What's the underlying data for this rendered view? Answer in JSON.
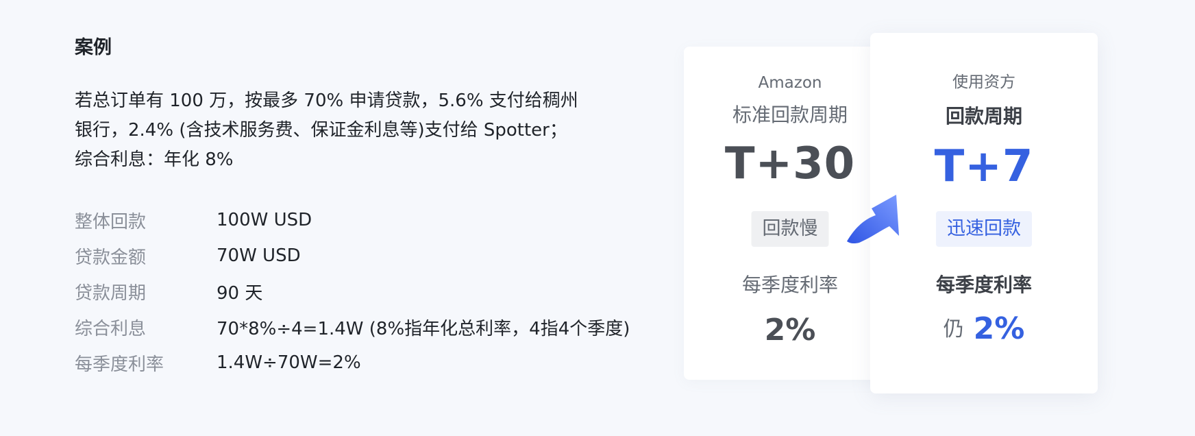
{
  "case": {
    "title": "案例",
    "lines": [
      "若总订单有 100 万，按最多 70% 申请贷款，5.6% 支付给稠州",
      "银行，2.4% (含技术服务费、保证金利息等)支付给 Spotter；",
      "综合利息：年化 8%"
    ],
    "rows": [
      {
        "label": "整体回款",
        "value": "100W USD"
      },
      {
        "label": "贷款金额",
        "value": "70W USD"
      },
      {
        "label": "贷款周期",
        "value": "90 天"
      },
      {
        "label": "综合利息",
        "value": "70*8%÷4=1.4W (8%指年化总利率，4指4个季度)"
      },
      {
        "label": "每季度利率",
        "value": "1.4W÷70W=2%"
      }
    ]
  },
  "amazon": {
    "head": "Amazon",
    "cycle_label": "标准回款周期",
    "cycle_value": "T+30",
    "badge": "回款慢",
    "rate_label": "每季度利率",
    "rate_value": "2%"
  },
  "user": {
    "head": "使用资方",
    "cycle_label": "回款周期",
    "cycle_value": "T+7",
    "badge": "迅速回款",
    "rate_label": "每季度利率",
    "rate_prefix": "仍",
    "rate_value": "2%"
  },
  "colors": {
    "accent": "#3561e0",
    "background": "#f6f8fc",
    "card": "#ffffff",
    "muted": "#8a8f99"
  },
  "icons": {
    "transition_arrow": "curved-up-right-arrow-icon"
  }
}
